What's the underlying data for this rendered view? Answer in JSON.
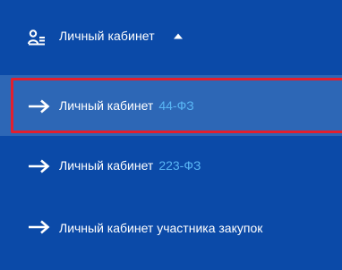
{
  "menu": {
    "header": {
      "label": "Личный кабинет",
      "icon": "user-list-icon",
      "caret_icon": "caret-up-icon"
    },
    "items": [
      {
        "label": "Личный кабинет",
        "suffix": "44-ФЗ",
        "icon": "arrow-right-icon",
        "active": true
      },
      {
        "label": "Личный кабинет",
        "suffix": "223-ФЗ",
        "icon": "arrow-right-icon",
        "active": false
      },
      {
        "label": "Личный кабинет участника закупок",
        "suffix": "",
        "icon": "arrow-right-icon",
        "active": false
      }
    ]
  },
  "colors": {
    "background": "#0b4aa8",
    "active_background": "#2d67b6",
    "suffix_text": "#59b6f5",
    "highlight_border": "#e2202e",
    "text": "#ffffff"
  }
}
